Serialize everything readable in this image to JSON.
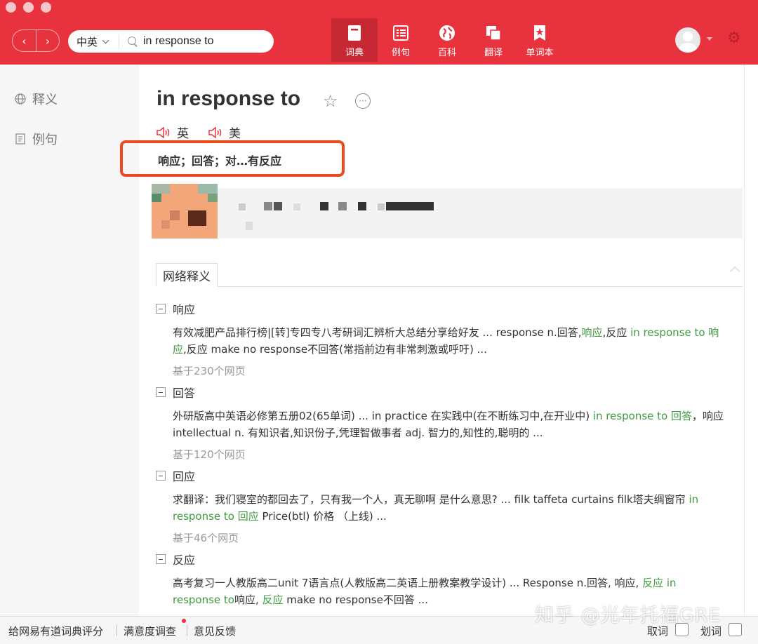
{
  "colors": {
    "brand": "#e8333f",
    "brand_dark": "#c72934",
    "highlight_box": "#ea4a1c",
    "link_green": "#3f9b3f"
  },
  "toolbar": {
    "lang_select": "中英",
    "search_value": "in response to",
    "tabs": [
      {
        "label": "词典",
        "icon": "dictionary-icon",
        "active": true
      },
      {
        "label": "例句",
        "icon": "sentences-icon",
        "active": false
      },
      {
        "label": "百科",
        "icon": "globe-icon",
        "active": false
      },
      {
        "label": "翻译",
        "icon": "translate-icon",
        "active": false
      },
      {
        "label": "单词本",
        "icon": "wordbook-icon",
        "active": false
      }
    ]
  },
  "sidebar": {
    "items": [
      {
        "label": "释义",
        "icon": "globe-icon"
      },
      {
        "label": "例句",
        "icon": "document-icon"
      }
    ]
  },
  "entry": {
    "headword": "in response to",
    "pron_uk": "英",
    "pron_us": "美",
    "translation": "响应；回答；对…有反应"
  },
  "web_section": {
    "tab_label": "网络释义",
    "items": [
      {
        "term": "响应",
        "text": [
          {
            "t": "有效减肥产品排行榜|[转]专四专八考研词汇辨析大总结分享给好友 ... response n.回答,",
            "g": false
          },
          {
            "t": "响应",
            "g": true
          },
          {
            "t": ",反应 ",
            "g": false
          },
          {
            "t": "in response to 响应",
            "g": true
          },
          {
            "t": ",反应 make no response不回答(常指前边有非常刺激或呼吁) ...",
            "g": false
          }
        ],
        "source": "基于230个网页"
      },
      {
        "term": "回答",
        "text": [
          {
            "t": "外研版高中英语必修第五册02(65单词) ... in practice 在实践中(在不断练习中,在开业中) ",
            "g": false
          },
          {
            "t": "in response to 回答",
            "g": true
          },
          {
            "t": "，响应 intellectual n. 有知识者,知识份子,凭理智做事者 adj. 智力的,知性的,聪明的 ...",
            "g": false
          }
        ],
        "source": "基于120个网页"
      },
      {
        "term": "回应",
        "text": [
          {
            "t": "求翻译：我们寝室的都回去了，只有我一个人，真无聊啊 是什么意思? ... filk taffeta curtains filk塔夫绸窗帘 ",
            "g": false
          },
          {
            "t": "in response to 回应",
            "g": true
          },
          {
            "t": " Price(btl) 价格 （上线) ...",
            "g": false
          }
        ],
        "source": "基于46个网页"
      },
      {
        "term": "反应",
        "text": [
          {
            "t": "高考复习一人教版高二unit 7语言点(人教版高二英语上册教案教学设计) ... Response n.回答, 响应, ",
            "g": false
          },
          {
            "t": "反应 in response to",
            "g": true
          },
          {
            "t": "响应, ",
            "g": false
          },
          {
            "t": "反应",
            "g": true
          },
          {
            "t": " make no response不回答 ...",
            "g": false
          }
        ],
        "source": ""
      }
    ]
  },
  "bottom": {
    "rate": "给网易有道词典评分",
    "survey": "满意度调查",
    "feedback": "意见反馈",
    "pick_word": "取词",
    "select_word": "划词"
  },
  "watermark": "知乎 @光年托福GRE"
}
